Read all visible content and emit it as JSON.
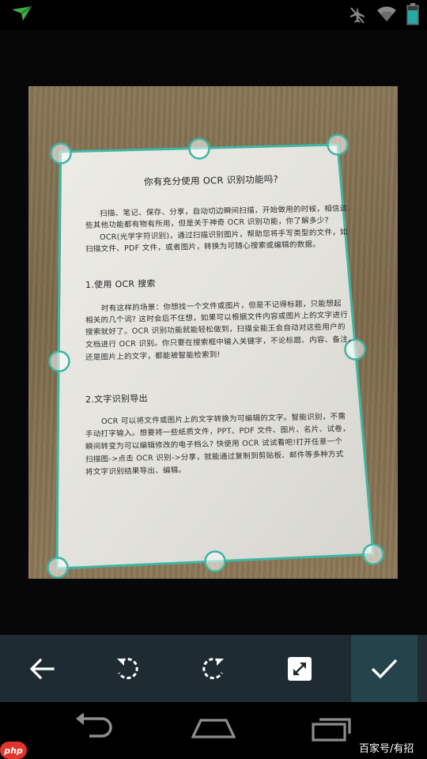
{
  "document": {
    "title": "你有充分使用 OCR 识别功能吗?",
    "intro": [
      "扫描、笔记、保存、分享，自动切边瞬间扫描，开始做用的时候，相信这",
      "些其他功能都有物有所用，但是关于神奇 OCR 识别功能，你了解多少?",
      "OCR(光学字符识别)，通过扫描识别图片，帮助您将手写类型的文件，如",
      "扫描文件、PDF 文件，或者图片，转换为可随心搜索或编辑的数据。"
    ],
    "section1_heading": "1.使用 OCR 搜索",
    "section1": [
      "时有这样的场景：你想找一个文件或图片，但是不记得标题，只能想起",
      "相关的几个词? 这时会后不住想，如果可以根据文件内容或图片上的文字进行",
      "搜索就好了。OCR 识别功能就能轻松做到，扫描全能王会自动对这些用户的",
      "文档进行 OCR 识别。你只要在搜索框中输入关键字，不论标题、内容、备注，",
      "还是图片上的文字，都能被智能检索到!"
    ],
    "section2_heading": "2.文字识别导出",
    "section2": [
      "OCR 可以将文件或图片上的文字转换为可编辑的文字。智能识别，不需",
      "手动打字输入。想要将一些纸质文件，PPT、PDF 文件、图片、名片、试卷，",
      "瞬间转变为可以编辑修改的电子档么? 快使用 OCR 试试看吧!打开任意一个",
      "扫描图->点击 OCR 识别->分享，就能通过复制到剪贴板、邮件等多种方式",
      "将文字识别结果导出、编辑。"
    ]
  },
  "watermark": "百家号/有招",
  "badge": "php",
  "colors": {
    "accent": "#3fb5a4",
    "toolbar": "#1e2b33",
    "confirm": "#24434a"
  },
  "icons": {
    "status": [
      "notification-icon",
      "airplane-mode-icon",
      "wifi-icon",
      "battery-icon"
    ],
    "toolbar": [
      "back-arrow-icon",
      "rotate-left-icon",
      "rotate-right-icon",
      "expand-icon",
      "checkmark-icon"
    ],
    "nav": [
      "nav-back-icon",
      "nav-home-icon",
      "nav-recents-icon"
    ]
  }
}
